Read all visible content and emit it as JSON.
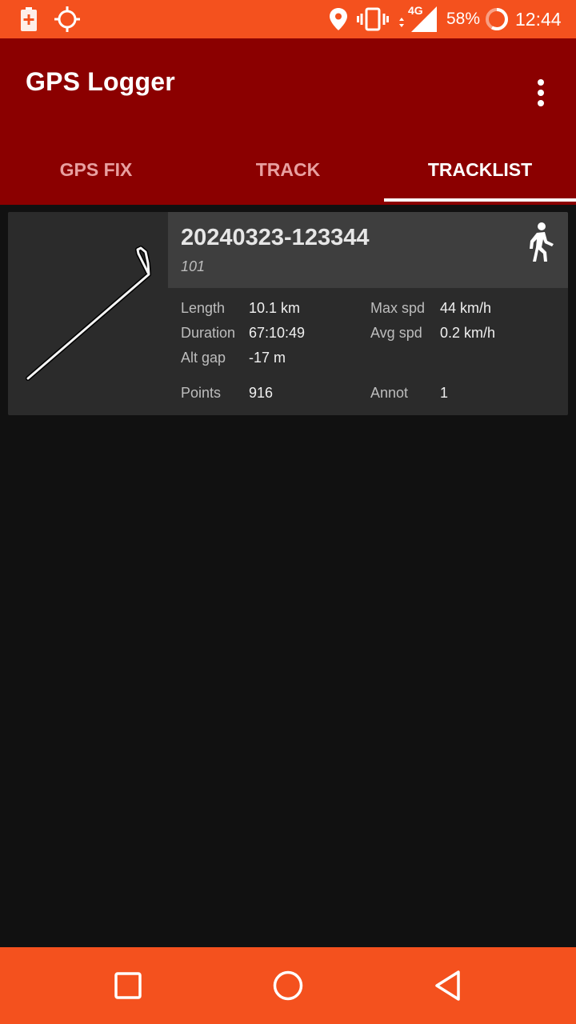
{
  "status_bar": {
    "icons": [
      "battery-saver-icon",
      "gps-fix-icon",
      "location-icon",
      "vibrate-icon",
      "network-4g-icon",
      "signal-icon",
      "battery-ring-icon"
    ],
    "network_label": "4G",
    "battery_percent": "58%",
    "battery_level": 0.58,
    "time": "12:44",
    "background_color": "#f4511e"
  },
  "app_bar": {
    "title": "GPS Logger",
    "overflow_icon": "more-vert-icon",
    "background_color": "#8b0000"
  },
  "tabs": [
    {
      "label": "GPS FIX",
      "active": false
    },
    {
      "label": "TRACK",
      "active": false
    },
    {
      "label": "TRACKLIST",
      "active": true
    }
  ],
  "tracks": [
    {
      "name": "20240323-123344",
      "description": "101",
      "activity_icon": "walking-icon",
      "stats": {
        "length_label": "Length",
        "length_value": "10.1 km",
        "duration_label": "Duration",
        "duration_value": "67:10:49",
        "altgap_label": "Alt gap",
        "altgap_value": "-17 m",
        "points_label": "Points",
        "points_value": "916",
        "maxspd_label": "Max spd",
        "maxspd_value": "44 km/h",
        "avgspd_label": "Avg spd",
        "avgspd_value": "0.2 km/h",
        "annot_label": "Annot",
        "annot_value": "1"
      }
    }
  ],
  "nav_bar": {
    "buttons": [
      "recents-square-icon",
      "home-circle-icon",
      "back-triangle-icon"
    ],
    "background_color": "#f4511e"
  }
}
